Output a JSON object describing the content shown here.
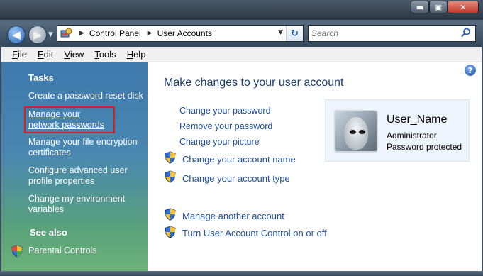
{
  "window": {
    "minimize": "▬",
    "maximize": "▣",
    "close": "✕"
  },
  "nav": {
    "back_glyph": "◀",
    "forward_glyph": "▶",
    "breadcrumbs": [
      "Control Panel",
      "User Accounts"
    ],
    "refresh_glyph": "↻"
  },
  "search": {
    "placeholder": "Search"
  },
  "menu": [
    "File",
    "Edit",
    "View",
    "Tools",
    "Help"
  ],
  "tasks": {
    "heading": "Tasks",
    "items": [
      "Create a password reset disk",
      "Manage your network passwords",
      "Manage your file encryption certificates",
      "Configure advanced user profile properties",
      "Change my environment variables"
    ],
    "see_also_heading": "See also",
    "see_also_items": [
      "Parental Controls"
    ]
  },
  "main": {
    "heading": "Make changes to your user account",
    "plain_links": [
      "Change your password",
      "Remove your password",
      "Change your picture"
    ],
    "shield_links_1": [
      "Change your account name",
      "Change your account type"
    ],
    "shield_links_2": [
      "Manage another account",
      "Turn User Account Control on or off"
    ]
  },
  "user": {
    "name": "User_Name",
    "role": "Administrator",
    "status": "Password protected"
  },
  "icons": {
    "help": "help-icon",
    "shield": "uac-shield-icon",
    "control_panel": "control-panel-icon",
    "search": "search-icon"
  }
}
